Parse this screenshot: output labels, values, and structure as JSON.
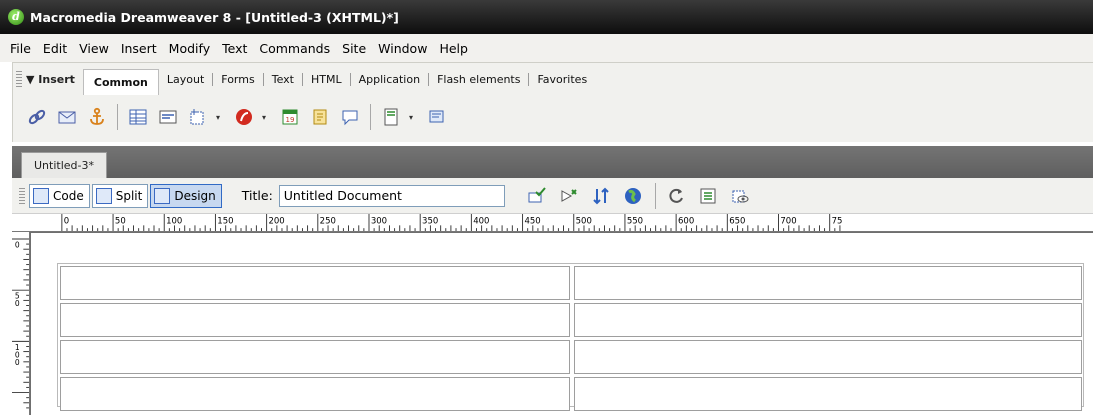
{
  "window": {
    "title": "Macromedia Dreamweaver 8 - [Untitled-3 (XHTML)*]"
  },
  "menu": [
    "File",
    "Edit",
    "View",
    "Insert",
    "Modify",
    "Text",
    "Commands",
    "Site",
    "Window",
    "Help"
  ],
  "insert_bar": {
    "label": "▼ Insert",
    "active_tab": "Common",
    "tabs": [
      "Layout",
      "Forms",
      "Text",
      "HTML",
      "Application",
      "Flash elements",
      "Favorites"
    ],
    "icons": [
      "hyperlink-icon",
      "email-link-icon",
      "named-anchor-icon",
      "table-icon",
      "div-tag-icon",
      "image-icon",
      "media-icon",
      "date-icon",
      "comment-icon",
      "head-icon",
      "script-icon",
      "templates-icon",
      "tag-chooser-icon"
    ]
  },
  "document": {
    "tab_label": "Untitled-3*",
    "views": {
      "code": "Code",
      "split": "Split",
      "design": "Design"
    },
    "title_label": "Title:",
    "title_value": "Untitled Document",
    "toolbar_icons": [
      "validate-icon",
      "file-management-icon",
      "sync-icon",
      "preview-browser-icon",
      "refresh-icon",
      "view-options-icon",
      "visual-aids-icon"
    ]
  },
  "rulers": {
    "h_labels": [
      "0",
      "50",
      "100",
      "150",
      "200",
      "250",
      "300",
      "350",
      "400",
      "450",
      "500",
      "550",
      "600",
      "650",
      "700",
      "75"
    ],
    "v_labels": [
      "0",
      "5\n0",
      "1\n0\n0"
    ]
  },
  "table": {
    "rows": 4,
    "cols": 2
  },
  "colors": {
    "titlebar": "#1a1a1a",
    "chrome": "#f1f1ee",
    "doc_frame": "#6f6f6f",
    "active_view": "#c7d8f0"
  }
}
